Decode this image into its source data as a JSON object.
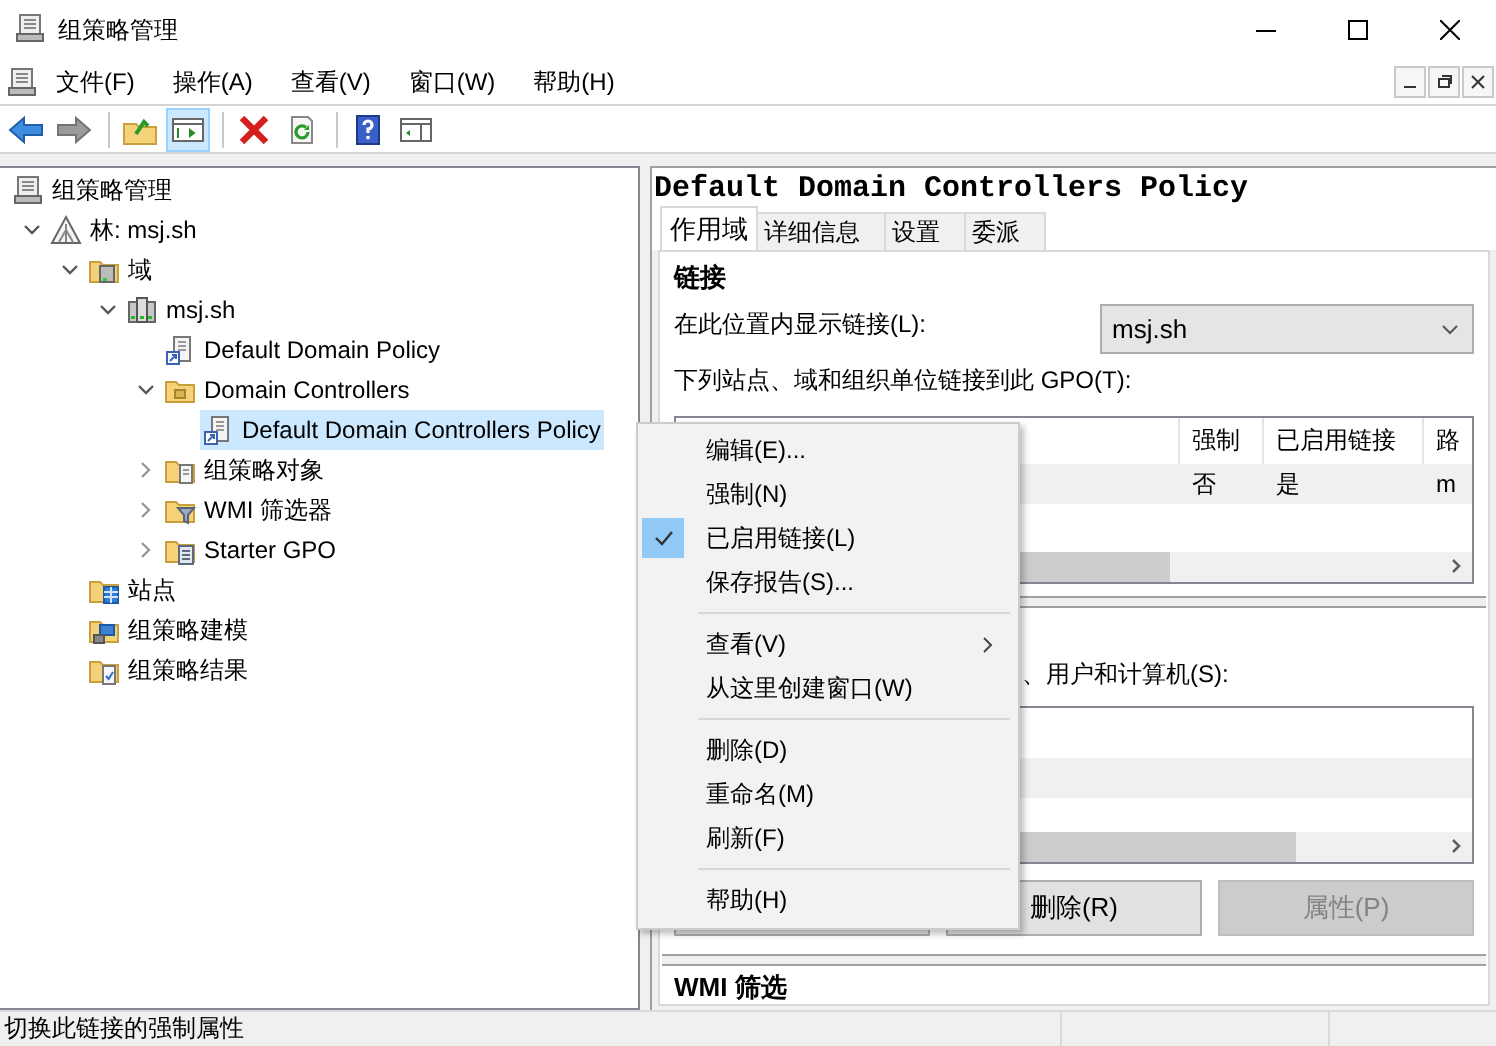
{
  "window": {
    "title": "组策略管理"
  },
  "menu": [
    "文件(F)",
    "操作(A)",
    "查看(V)",
    "窗口(W)",
    "帮助(H)"
  ],
  "toolbar": [
    {
      "kind": "back",
      "pressed": false,
      "disabled": false
    },
    {
      "kind": "forward",
      "pressed": false,
      "disabled": true
    },
    {
      "kind": "separator"
    },
    {
      "kind": "up",
      "pressed": false,
      "disabled": false
    },
    {
      "kind": "pane",
      "pressed": true,
      "disabled": false
    },
    {
      "kind": "separator"
    },
    {
      "kind": "delete",
      "pressed": false,
      "disabled": false
    },
    {
      "kind": "refresh",
      "pressed": false,
      "disabled": false
    },
    {
      "kind": "separator"
    },
    {
      "kind": "help",
      "pressed": false,
      "disabled": false
    },
    {
      "kind": "action-pane",
      "pressed": false,
      "disabled": false
    }
  ],
  "tree": {
    "items": [
      {
        "label": "组策略管理",
        "kind": "console",
        "selected": false,
        "children": [
          {
            "label": "林: msj.sh",
            "kind": "forest",
            "expanded": true,
            "selected": false,
            "children": [
              {
                "label": "域",
                "kind": "domains",
                "expanded": true,
                "selected": false,
                "children": [
                  {
                    "label": "msj.sh",
                    "kind": "domain",
                    "expanded": true,
                    "selected": false,
                    "children": [
                      {
                        "label": "Default Domain Policy",
                        "kind": "gpo-link",
                        "selected": false
                      },
                      {
                        "label": "Domain Controllers",
                        "kind": "ou",
                        "expanded": true,
                        "selected": false,
                        "children": [
                          {
                            "label": "Default Domain Controllers Policy",
                            "kind": "gpo-link",
                            "selected": true
                          }
                        ]
                      },
                      {
                        "label": "组策略对象",
                        "kind": "gpo-folder",
                        "expanded": false,
                        "selected": false
                      },
                      {
                        "label": "WMI 筛选器",
                        "kind": "wmi-folder",
                        "expanded": false,
                        "selected": false
                      },
                      {
                        "label": "Starter GPO",
                        "kind": "starter-folder",
                        "expanded": false,
                        "selected": false
                      }
                    ]
                  }
                ]
              },
              {
                "label": "站点",
                "kind": "sites",
                "selected": false
              },
              {
                "label": "组策略建模",
                "kind": "modeling",
                "selected": false
              },
              {
                "label": "组策略结果",
                "kind": "results",
                "selected": false
              }
            ]
          }
        ]
      }
    ]
  },
  "details": {
    "title": "Default Domain Controllers Policy",
    "tabs": [
      {
        "label": "作用域",
        "selected": true
      },
      {
        "label": "详细信息",
        "selected": false
      },
      {
        "label": "设置",
        "selected": false
      },
      {
        "label": "委派",
        "selected": false
      }
    ],
    "links": {
      "heading": "链接",
      "location_label": "在此位置内显示链接(L):",
      "location_value": "msj.sh",
      "list_label": "下列站点、域和组织单位链接到此 GPO(T):",
      "table": {
        "columns": [
          "强制",
          "已启用链接",
          "路"
        ],
        "rows": [
          {
            "cells": [
              "否",
              "是",
              "m"
            ],
            "selected": true
          }
        ]
      }
    },
    "security_filtering": {
      "label": "、用户和计算机(S):",
      "rows": [
        {
          "selected": false
        },
        {
          "selected": true
        }
      ],
      "buttons": [
        {
          "disabled": false
        },
        {
          "label": "删除(R)",
          "disabled": false
        },
        {
          "label": "属性(P)",
          "disabled": true
        }
      ]
    },
    "wmi_heading": "WMI 筛选"
  },
  "context_menu": [
    {
      "kind": "item",
      "label": "编辑(E)...",
      "checked": false
    },
    {
      "kind": "item",
      "label": "强制(N)",
      "checked": false
    },
    {
      "kind": "item",
      "label": "已启用链接(L)",
      "checked": true
    },
    {
      "kind": "item",
      "label": "保存报告(S)...",
      "checked": false
    },
    {
      "kind": "separator"
    },
    {
      "kind": "item",
      "label": "查看(V)",
      "checked": false,
      "submenu": true
    },
    {
      "kind": "item",
      "label": "从这里创建窗口(W)",
      "checked": false
    },
    {
      "kind": "separator"
    },
    {
      "kind": "item",
      "label": "删除(D)",
      "checked": false
    },
    {
      "kind": "item",
      "label": "重命名(M)",
      "checked": false
    },
    {
      "kind": "item",
      "label": "刷新(F)",
      "checked": false
    },
    {
      "kind": "separator"
    },
    {
      "kind": "item",
      "label": "帮助(H)",
      "checked": false
    }
  ],
  "status_bar": {
    "text": "切换此链接的强制属性"
  }
}
